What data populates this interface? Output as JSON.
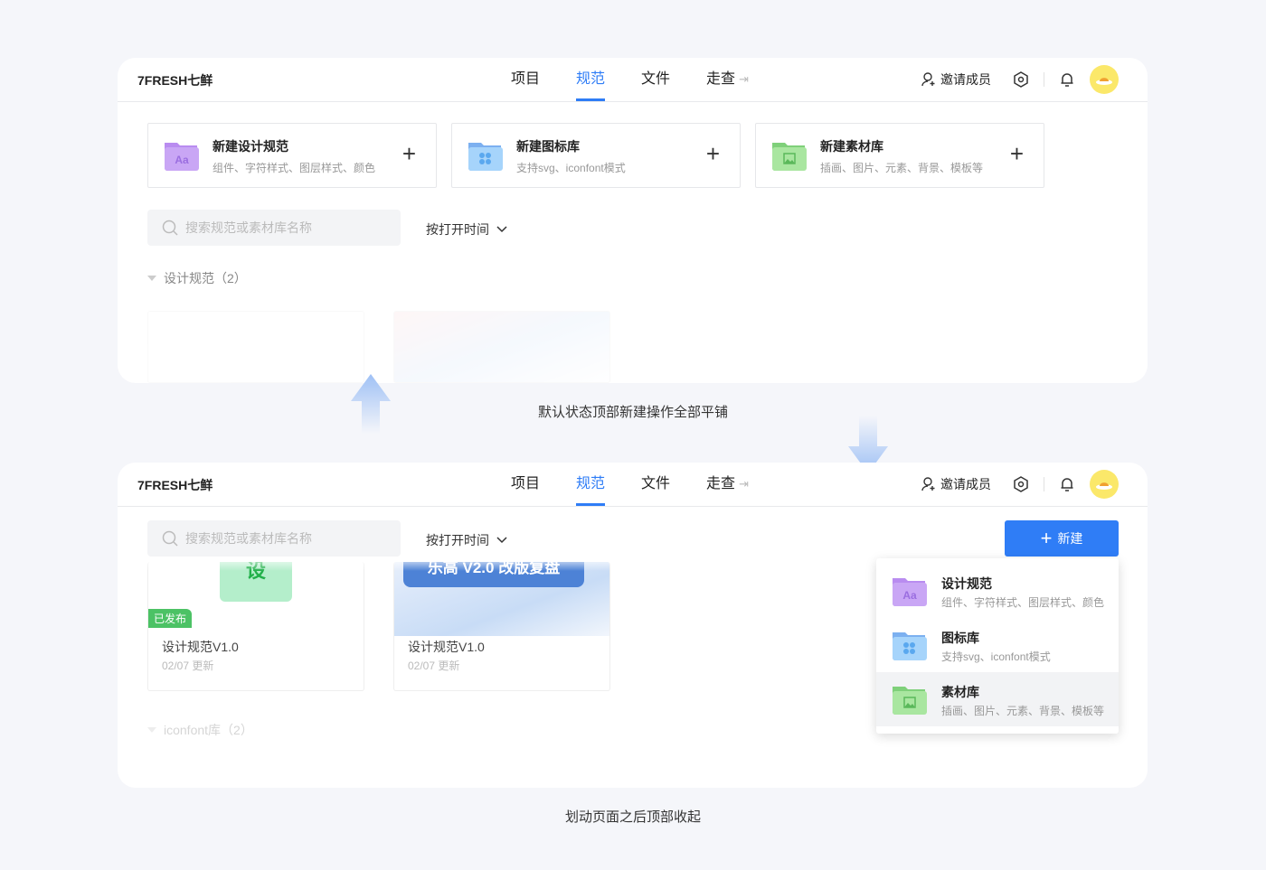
{
  "header": {
    "logo": "7FRESH七鲜",
    "nav": [
      {
        "label": "项目"
      },
      {
        "label": "规范",
        "active": true
      },
      {
        "label": "文件"
      },
      {
        "label": "走查"
      }
    ],
    "invite": "邀请成员",
    "icons": [
      "user-add-icon",
      "settings-hex-icon",
      "bell-icon",
      "avatar"
    ]
  },
  "create_cards": [
    {
      "title": "新建设计规范",
      "desc": "组件、字符样式、图层样式、颜色",
      "icon": "folder-aa-icon",
      "color": "#b98cf0"
    },
    {
      "title": "新建图标库",
      "desc": "支持svg、iconfont模式",
      "icon": "folder-grid-icon",
      "color": "#7cc0f8"
    },
    {
      "title": "新建素材库",
      "desc": "插画、图片、元素、背景、模板等",
      "icon": "folder-image-icon",
      "color": "#8edc8a"
    }
  ],
  "search": {
    "placeholder": "搜索规范或素材库名称"
  },
  "sort": {
    "label": "按打开时间"
  },
  "sections": {
    "design": "设计规范（2）",
    "iconfont": "iconfont库（2）"
  },
  "captions": {
    "top": "默认状态顶部新建操作全部平铺",
    "bottom": "划动页面之后顶部收起"
  },
  "thumbs": [
    {
      "badge": "已发布",
      "title": "设计规范V1.0",
      "date": "02/07 更新",
      "image_text": "设"
    },
    {
      "title": "设计规范V1.0",
      "date": "02/07 更新",
      "image_text": "乐高 V2.0 改版复盘"
    }
  ],
  "new_button": {
    "label": "新建"
  },
  "new_menu": [
    {
      "title": "设计规范",
      "desc": "组件、字符样式、图层样式、颜色"
    },
    {
      "title": "图标库",
      "desc": "支持svg、iconfont模式"
    },
    {
      "title": "素材库",
      "desc": "插画、图片、元素、背景、模板等",
      "hovered": true
    }
  ]
}
